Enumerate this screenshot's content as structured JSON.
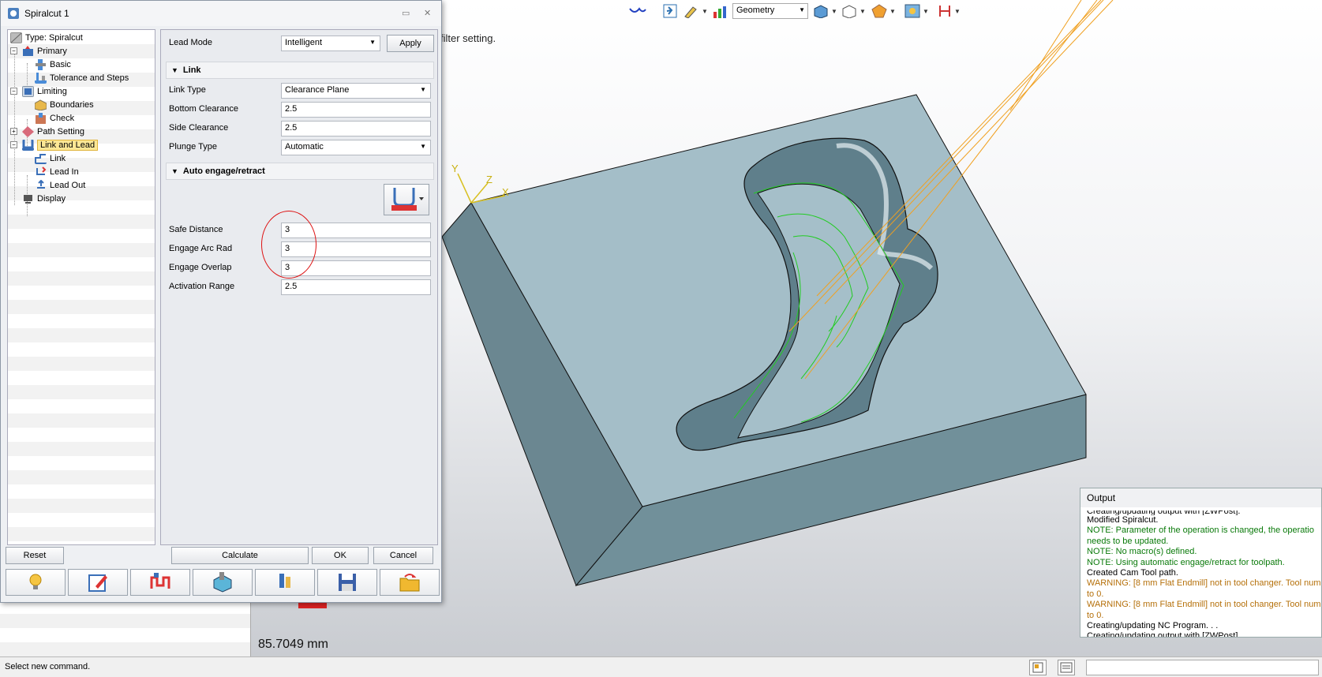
{
  "toolbar": {
    "geometry_select": "Geometry"
  },
  "viewport": {
    "hint": "filter setting.",
    "measure": "85.7049 mm",
    "axes": {
      "y": "Y",
      "z": "Z",
      "x": "X"
    }
  },
  "dialog": {
    "title": "Spiralcut 1",
    "tree": [
      {
        "label": "Type: Spiralcut",
        "icon": "type-icon"
      },
      {
        "label": "Primary",
        "icon": "primary-icon"
      },
      {
        "label": "Basic",
        "icon": "basic-icon"
      },
      {
        "label": "Tolerance and Steps",
        "icon": "tolerance-icon"
      },
      {
        "label": "Limiting",
        "icon": "limiting-icon"
      },
      {
        "label": "Boundaries",
        "icon": "boundaries-icon"
      },
      {
        "label": "Check",
        "icon": "check-icon"
      },
      {
        "label": "Path Setting",
        "icon": "path-setting-icon"
      },
      {
        "label": "Link and Lead",
        "icon": "link-lead-icon"
      },
      {
        "label": "Link",
        "icon": "link-icon"
      },
      {
        "label": "Lead In",
        "icon": "lead-in-icon"
      },
      {
        "label": "Lead Out",
        "icon": "lead-out-icon"
      },
      {
        "label": "Display",
        "icon": "display-icon"
      }
    ],
    "lead_mode": {
      "label": "Lead Mode",
      "value": "Intelligent",
      "apply": "Apply"
    },
    "link_section": {
      "title": "Link",
      "link_type": {
        "label": "Link Type",
        "value": "Clearance Plane"
      },
      "bottom_clearance": {
        "label": "Bottom Clearance",
        "value": "2.5"
      },
      "side_clearance": {
        "label": "Side Clearance",
        "value": "2.5"
      },
      "plunge_type": {
        "label": "Plunge Type",
        "value": "Automatic"
      }
    },
    "auto_section": {
      "title": "Auto engage/retract",
      "safe_distance": {
        "label": "Safe Distance",
        "value": "3"
      },
      "engage_arc_rad": {
        "label": "Engage Arc Rad",
        "value": "3"
      },
      "engage_overlap": {
        "label": "Engage Overlap",
        "value": "3"
      },
      "activation_range": {
        "label": "Activation Range",
        "value": "2.5"
      }
    },
    "buttons": {
      "reset": "Reset",
      "calculate": "Calculate",
      "ok": "OK",
      "cancel": "Cancel"
    }
  },
  "output": {
    "title": "Output",
    "lines": [
      {
        "text": "Creating/updating output with [ZWPost].",
        "color": "black",
        "partial": true
      },
      {
        "text": "Modified Spiralcut.",
        "color": "black"
      },
      {
        "text": "NOTE: Parameter of the operation is changed, the operatio",
        "color": "green"
      },
      {
        "text": "needs to be updated.",
        "color": "green"
      },
      {
        "text": "NOTE: No macro(s) defined.",
        "color": "green"
      },
      {
        "text": "NOTE: Using automatic engage/retract for toolpath.",
        "color": "green"
      },
      {
        "text": "Created Cam Tool path.",
        "color": "black"
      },
      {
        "text": "WARNING: [8 mm Flat Endmill] not in tool changer.  Tool num",
        "color": "orange"
      },
      {
        "text": "to 0.",
        "color": "orange"
      },
      {
        "text": "WARNING: [8 mm Flat Endmill] not in tool changer.  Tool num",
        "color": "orange"
      },
      {
        "text": "to 0.",
        "color": "orange"
      },
      {
        "text": "Creating/updating NC Program. . .",
        "color": "black"
      },
      {
        "text": "Creating/updating output with [ZWPost].",
        "color": "black"
      }
    ]
  },
  "status": {
    "text": "Select new command."
  }
}
